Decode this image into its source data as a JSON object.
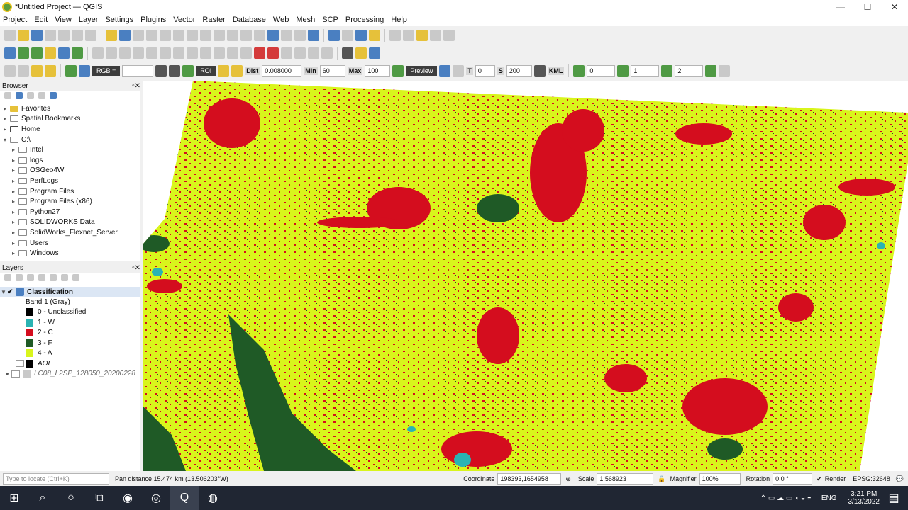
{
  "window": {
    "title": "*Untitled Project — QGIS",
    "min": "—",
    "max": "☐",
    "close": "✕"
  },
  "menu": [
    "Project",
    "Edit",
    "View",
    "Layer",
    "Settings",
    "Plugins",
    "Vector",
    "Raster",
    "Database",
    "Web",
    "Mesh",
    "SCP",
    "Processing",
    "Help"
  ],
  "scp_toolbar": {
    "rgb_label": "RGB =",
    "roi_label": "ROI",
    "dist_label": "Dist",
    "dist_value": "0.008000",
    "min_label": "Min",
    "min_value": "60",
    "max_label": "Max",
    "max_value": "100",
    "preview_label": "Preview",
    "t_label": "T",
    "t_value": "0",
    "s_label": "S",
    "s_value": "200",
    "kml_label": "KML",
    "field1": "0",
    "field2": "1",
    "field3": "2"
  },
  "browser": {
    "title": "Browser",
    "items": [
      {
        "label": "Favorites",
        "kind": "star"
      },
      {
        "label": "Spatial Bookmarks",
        "kind": "bookmark"
      },
      {
        "label": "Home",
        "kind": "home"
      },
      {
        "label": "C:\\",
        "kind": "drive"
      },
      {
        "label": "Intel",
        "kind": "folder"
      },
      {
        "label": "logs",
        "kind": "folder"
      },
      {
        "label": "OSGeo4W",
        "kind": "folder"
      },
      {
        "label": "PerfLogs",
        "kind": "folder"
      },
      {
        "label": "Program Files",
        "kind": "folder"
      },
      {
        "label": "Program Files (x86)",
        "kind": "folder"
      },
      {
        "label": "Python27",
        "kind": "folder"
      },
      {
        "label": "SOLIDWORKS Data",
        "kind": "folder"
      },
      {
        "label": "SolidWorks_Flexnet_Server",
        "kind": "folder"
      },
      {
        "label": "Users",
        "kind": "folder"
      },
      {
        "label": "Windows",
        "kind": "folder"
      }
    ]
  },
  "layers": {
    "title": "Layers",
    "classification": "Classification",
    "band": "Band 1 (Gray)",
    "legend": [
      {
        "label": "0 - Unclassified",
        "color": "#000000"
      },
      {
        "label": "1 - W",
        "color": "#2ab3b3"
      },
      {
        "label": "2 - C",
        "color": "#d40d1e"
      },
      {
        "label": "3 - F",
        "color": "#1f5a26"
      },
      {
        "label": "4 - A",
        "color": "#d9f51c"
      }
    ],
    "aoi": "AOI",
    "landsat": "LC08_L2SP_128050_20200228"
  },
  "status": {
    "locate_placeholder": "Type to locate (Ctrl+K)",
    "message": "Pan distance 15.474 km (13.506203°W)",
    "coordinate_label": "Coordinate",
    "coordinate_value": "198393,1654958",
    "scale_label": "Scale",
    "scale_value": "1:568923",
    "magnifier_label": "Magnifier",
    "magnifier_value": "100%",
    "rotation_label": "Rotation",
    "rotation_value": "0.0 °",
    "render_label": "Render",
    "crs": "EPSG:32648"
  },
  "taskbar": {
    "lang": "ENG",
    "time": "3:21 PM",
    "date": "3/13/2022"
  },
  "colors": {
    "agri": "#d9f51c",
    "built": "#d40d1e",
    "forest": "#1f5a26",
    "water": "#2ab3b3"
  }
}
